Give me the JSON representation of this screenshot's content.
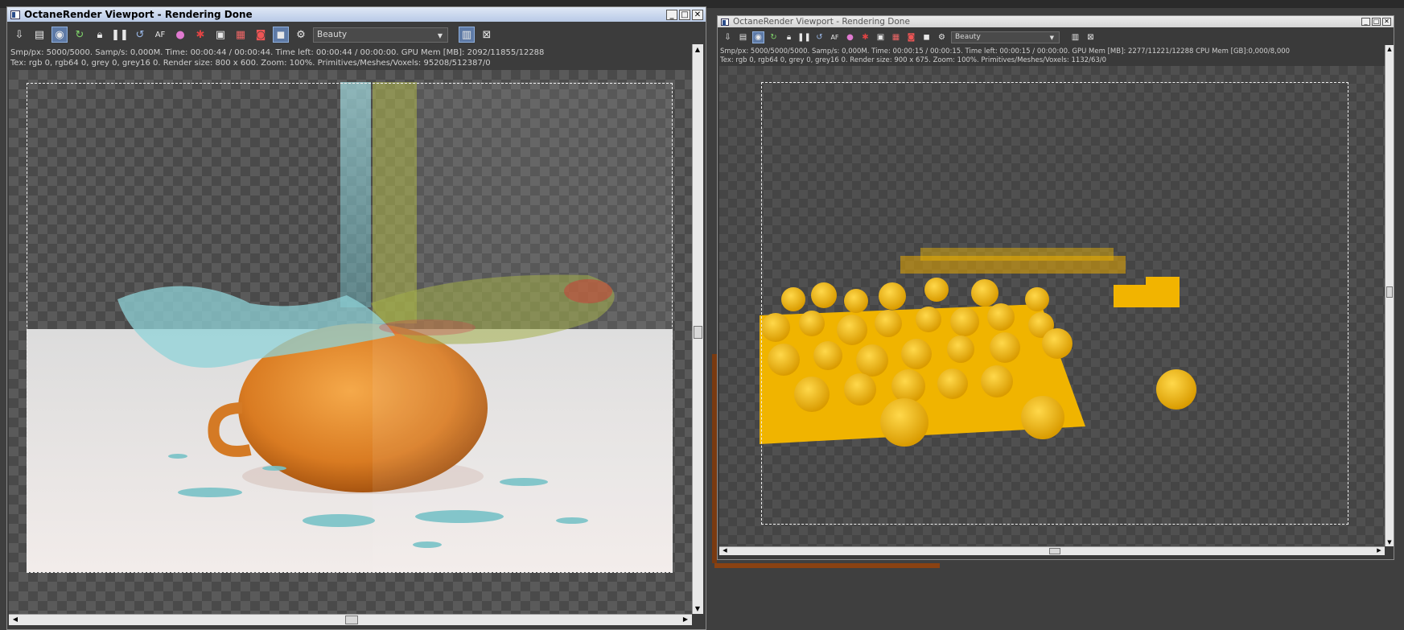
{
  "window1": {
    "title": "OctaneRender Viewport - Rendering Done",
    "toolbar_icons": [
      "export-icon",
      "save-icon",
      "zoom-region-icon",
      "refresh-icon",
      "lock-icon",
      "pause-icon",
      "restart-icon",
      "focus-picker-icon",
      "material-picker-icon",
      "object-picker-icon",
      "camera-settings-icon",
      "snapshot-icon",
      "compare-icon",
      "render-region-icon",
      "settings-gear-icon",
      "layout-icon",
      "clear-icon"
    ],
    "pass_select": "Beauty",
    "info_line1": "Smp/px: 5000/5000.   Samp/s: 0,000M.   Time: 00:00:44 / 00:00:44.   Time left: 00:00:44 / 00:00:00.   GPU Mem [MB]: 2092/11855/12288",
    "info_line2": "Tex: rgb 0, rgb64 0, grey 0, grey16 0.   Render size: 800 x 600.   Zoom: 100%.   Primitives/Meshes/Voxels: 95208/512387/0",
    "window_buttons": [
      "_",
      "□",
      "✕"
    ]
  },
  "window2": {
    "title": "OctaneRender Viewport - Rendering Done",
    "pass_select": "Beauty",
    "info_line1": "Smp/px: 5000/5000/5000.   Samp/s: 0,000M.   Time: 00:00:15 / 00:00:15.   Time left: 00:00:15 / 00:00:00.   GPU Mem [MB]: 2277/11221/12288   CPU Mem [GB]:0,000/8,000",
    "info_line2": "Tex: rgb 0, rgb64 0, grey 0, grey16 0.   Render size: 900 x 675.   Zoom: 100%.   Primitives/Meshes/Voxels: 1132/63/0",
    "window_buttons": [
      "_",
      "□",
      "✕"
    ]
  },
  "colors": {
    "accent": "#5e7aa6",
    "teapot": "#e8892c",
    "spheres": "#f5c000",
    "water": "#7fc8cf"
  }
}
